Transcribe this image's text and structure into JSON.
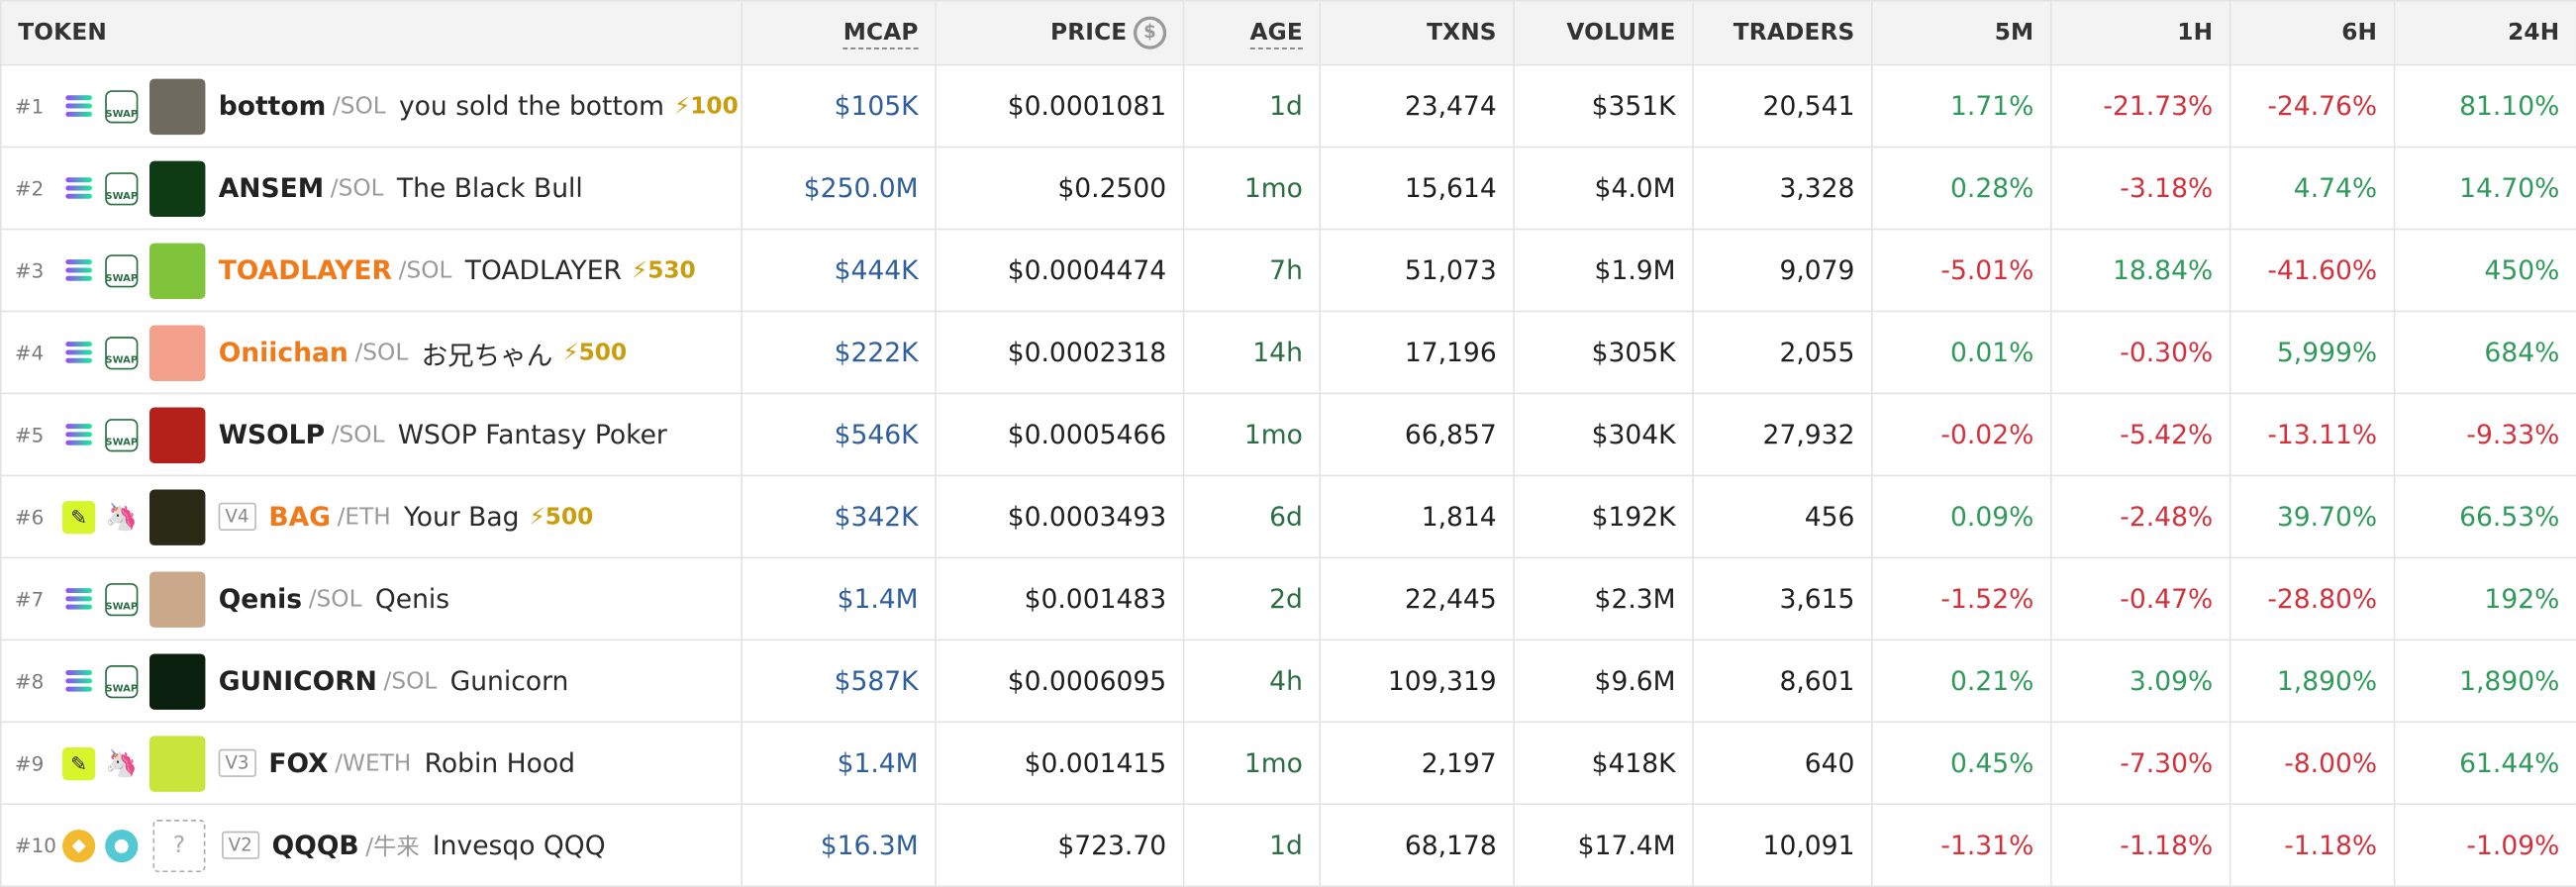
{
  "headers": {
    "token": "TOKEN",
    "mcap": "MCAP",
    "price": "PRICE",
    "age": "AGE",
    "txns": "TXNS",
    "volume": "VOLUME",
    "traders": "TRADERS",
    "m5": "5M",
    "h1": "1H",
    "h6": "6H",
    "h24": "24H"
  },
  "colors": {
    "up": "#2f9a59",
    "down": "#d3323d",
    "mcap": "#2f5e9c",
    "age": "#2b6e44",
    "boost": "#c99d0b",
    "orange": "#f07a19"
  },
  "rows": [
    {
      "rank": "#1",
      "chain_icon": "solana-icon",
      "dex_icon": "swap-icon",
      "avatar_color": "#6f6a5f",
      "version": "",
      "symbol": "bottom",
      "symbol_style": "dark",
      "pair": "/SOL",
      "name": "you sold the bottom",
      "boost": "⚡100",
      "mcap": "$105K",
      "price": "$0.0001081",
      "age": "1d",
      "txns": "23,474",
      "volume": "$351K",
      "traders": "20,541",
      "m5": "1.71%",
      "h1": "-21.73%",
      "h6": "-24.76%",
      "h24": "81.10%"
    },
    {
      "rank": "#2",
      "chain_icon": "solana-icon",
      "dex_icon": "swap-icon",
      "avatar_color": "#0e3a14",
      "version": "",
      "symbol": "ANSEM",
      "symbol_style": "dark",
      "pair": "/SOL",
      "name": "The Black Bull",
      "boost": "",
      "mcap": "$250.0M",
      "price": "$0.2500",
      "age": "1mo",
      "txns": "15,614",
      "volume": "$4.0M",
      "traders": "3,328",
      "m5": "0.28%",
      "h1": "-3.18%",
      "h6": "4.74%",
      "h24": "14.70%"
    },
    {
      "rank": "#3",
      "chain_icon": "solana-icon",
      "dex_icon": "swap-icon",
      "avatar_color": "#7fc43a",
      "version": "",
      "symbol": "TOADLAYER",
      "symbol_style": "orange",
      "pair": "/SOL",
      "name": "TOADLAYER",
      "boost": "⚡530",
      "mcap": "$444K",
      "price": "$0.0004474",
      "age": "7h",
      "txns": "51,073",
      "volume": "$1.9M",
      "traders": "9,079",
      "m5": "-5.01%",
      "h1": "18.84%",
      "h6": "-41.60%",
      "h24": "450%"
    },
    {
      "rank": "#4",
      "chain_icon": "solana-icon",
      "dex_icon": "swap-icon",
      "avatar_color": "#f3a08c",
      "version": "",
      "symbol": "Oniichan",
      "symbol_style": "orange",
      "pair": "/SOL",
      "name": "お兄ちゃん",
      "boost": "⚡500",
      "mcap": "$222K",
      "price": "$0.0002318",
      "age": "14h",
      "txns": "17,196",
      "volume": "$305K",
      "traders": "2,055",
      "m5": "0.01%",
      "h1": "-0.30%",
      "h6": "5,999%",
      "h24": "684%"
    },
    {
      "rank": "#5",
      "chain_icon": "solana-icon",
      "dex_icon": "swap-icon",
      "avatar_color": "#b3211a",
      "version": "",
      "symbol": "WSOLP",
      "symbol_style": "dark",
      "pair": "/SOL",
      "name": "WSOP Fantasy Poker",
      "boost": "",
      "mcap": "$546K",
      "price": "$0.0005466",
      "age": "1mo",
      "txns": "66,857",
      "volume": "$304K",
      "traders": "27,932",
      "m5": "-0.02%",
      "h1": "-5.42%",
      "h6": "-13.11%",
      "h24": "-9.33%"
    },
    {
      "rank": "#6",
      "chain_icon": "ethereum-icon",
      "dex_icon": "uniswap-icon",
      "avatar_color": "#2b2a16",
      "version": "V4",
      "symbol": "BAG",
      "symbol_style": "orange",
      "pair": "/ETH",
      "name": "Your Bag",
      "boost": "⚡500",
      "mcap": "$342K",
      "price": "$0.0003493",
      "age": "6d",
      "txns": "1,814",
      "volume": "$192K",
      "traders": "456",
      "m5": "0.09%",
      "h1": "-2.48%",
      "h6": "39.70%",
      "h24": "66.53%"
    },
    {
      "rank": "#7",
      "chain_icon": "solana-icon",
      "dex_icon": "swap-icon",
      "avatar_color": "#c9a98a",
      "version": "",
      "symbol": "Qenis",
      "symbol_style": "dark",
      "pair": "/SOL",
      "name": "Qenis",
      "boost": "",
      "mcap": "$1.4M",
      "price": "$0.001483",
      "age": "2d",
      "txns": "22,445",
      "volume": "$2.3M",
      "traders": "3,615",
      "m5": "-1.52%",
      "h1": "-0.47%",
      "h6": "-28.80%",
      "h24": "192%"
    },
    {
      "rank": "#8",
      "chain_icon": "solana-icon",
      "dex_icon": "swap-icon",
      "avatar_color": "#0b1f0e",
      "version": "",
      "symbol": "GUNICORN",
      "symbol_style": "dark",
      "pair": "/SOL",
      "name": "Gunicorn",
      "boost": "",
      "mcap": "$587K",
      "price": "$0.0006095",
      "age": "4h",
      "txns": "109,319",
      "volume": "$9.6M",
      "traders": "8,601",
      "m5": "0.21%",
      "h1": "3.09%",
      "h6": "1,890%",
      "h24": "1,890%"
    },
    {
      "rank": "#9",
      "chain_icon": "ethereum-icon",
      "dex_icon": "uniswap-icon",
      "avatar_color": "#c9e43a",
      "version": "V3",
      "symbol": "FOX",
      "symbol_style": "dark",
      "pair": "/WETH",
      "name": "Robin Hood",
      "boost": "",
      "mcap": "$1.4M",
      "price": "$0.001415",
      "age": "1mo",
      "txns": "2,197",
      "volume": "$418K",
      "traders": "640",
      "m5": "0.45%",
      "h1": "-7.30%",
      "h6": "-8.00%",
      "h24": "61.44%"
    },
    {
      "rank": "#10",
      "chain_icon": "bnb-icon",
      "dex_icon": "pancakeswap-icon",
      "avatar_color": "",
      "version": "V2",
      "symbol": "QQQB",
      "symbol_style": "dark",
      "pair": "/牛来",
      "name": "Invesqo QQQ",
      "boost": "",
      "mcap": "$16.3M",
      "price": "$723.70",
      "age": "1d",
      "txns": "68,178",
      "volume": "$17.4M",
      "traders": "10,091",
      "m5": "-1.31%",
      "h1": "-1.18%",
      "h6": "-1.18%",
      "h24": "-1.09%"
    }
  ]
}
